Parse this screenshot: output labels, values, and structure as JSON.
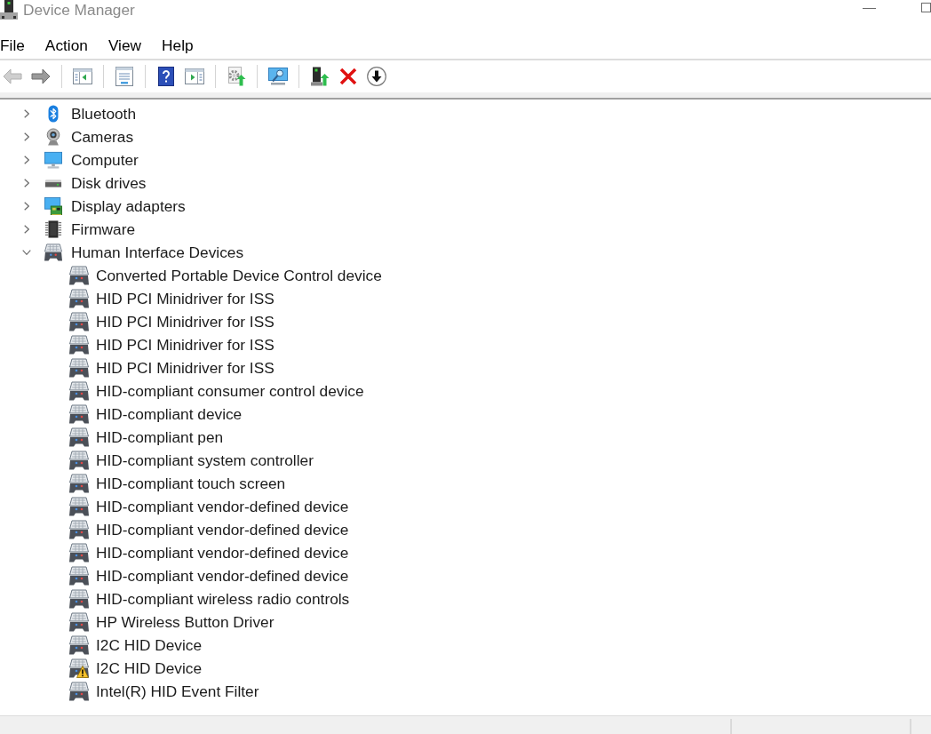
{
  "window": {
    "title": "Device Manager"
  },
  "menu": [
    {
      "label": "File"
    },
    {
      "label": "Action"
    },
    {
      "label": "View"
    },
    {
      "label": "Help"
    }
  ],
  "toolbar": [
    {
      "kind": "back",
      "disabled": true
    },
    {
      "kind": "forward",
      "disabled": false
    },
    {
      "kind": "separator"
    },
    {
      "kind": "tree",
      "disabled": false
    },
    {
      "kind": "separator"
    },
    {
      "kind": "properties",
      "disabled": false
    },
    {
      "kind": "separator"
    },
    {
      "kind": "help",
      "disabled": false
    },
    {
      "kind": "pane",
      "disabled": false
    },
    {
      "kind": "separator"
    },
    {
      "kind": "update",
      "disabled": false
    },
    {
      "kind": "separator"
    },
    {
      "kind": "scan",
      "disabled": false
    },
    {
      "kind": "separator"
    },
    {
      "kind": "enable",
      "disabled": false
    },
    {
      "kind": "uninstall",
      "disabled": false
    },
    {
      "kind": "disable",
      "disabled": false
    }
  ],
  "tree": [
    {
      "label": "Bluetooth",
      "kind": "bluetooth",
      "expanded": false
    },
    {
      "label": "Cameras",
      "kind": "camera",
      "expanded": false
    },
    {
      "label": "Computer",
      "kind": "computer",
      "expanded": false
    },
    {
      "label": "Disk drives",
      "kind": "disk",
      "expanded": false
    },
    {
      "label": "Display adapters",
      "kind": "display",
      "expanded": false
    },
    {
      "label": "Firmware",
      "kind": "firmware",
      "expanded": false
    },
    {
      "label": "Human Interface Devices",
      "kind": "hid",
      "expanded": true,
      "children": [
        {
          "label": "Converted Portable Device Control device",
          "kind": "hid",
          "warning": false
        },
        {
          "label": "HID PCI Minidriver for ISS",
          "kind": "hid",
          "warning": false
        },
        {
          "label": "HID PCI Minidriver for ISS",
          "kind": "hid",
          "warning": false
        },
        {
          "label": "HID PCI Minidriver for ISS",
          "kind": "hid",
          "warning": false
        },
        {
          "label": "HID PCI Minidriver for ISS",
          "kind": "hid",
          "warning": false
        },
        {
          "label": "HID-compliant consumer control device",
          "kind": "hid",
          "warning": false
        },
        {
          "label": "HID-compliant device",
          "kind": "hid",
          "warning": false
        },
        {
          "label": "HID-compliant pen",
          "kind": "hid",
          "warning": false
        },
        {
          "label": "HID-compliant system controller",
          "kind": "hid",
          "warning": false
        },
        {
          "label": "HID-compliant touch screen",
          "kind": "hid",
          "warning": false
        },
        {
          "label": "HID-compliant vendor-defined device",
          "kind": "hid",
          "warning": false
        },
        {
          "label": "HID-compliant vendor-defined device",
          "kind": "hid",
          "warning": false
        },
        {
          "label": "HID-compliant vendor-defined device",
          "kind": "hid",
          "warning": false
        },
        {
          "label": "HID-compliant vendor-defined device",
          "kind": "hid",
          "warning": false
        },
        {
          "label": "HID-compliant wireless radio controls",
          "kind": "hid",
          "warning": false
        },
        {
          "label": "HP Wireless Button Driver",
          "kind": "hid",
          "warning": false
        },
        {
          "label": "I2C HID Device",
          "kind": "hid",
          "warning": false
        },
        {
          "label": "I2C HID Device",
          "kind": "hid",
          "warning": true
        },
        {
          "label": "Intel(R) HID Event Filter",
          "kind": "hid",
          "warning": false
        }
      ]
    }
  ]
}
